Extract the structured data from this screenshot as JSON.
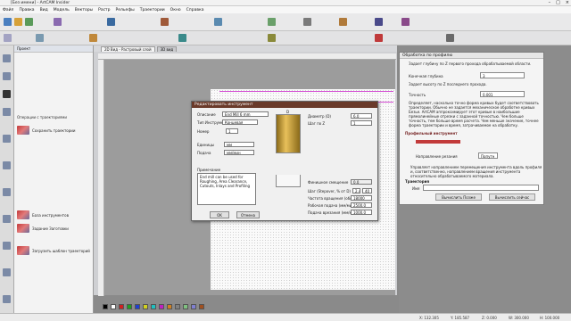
{
  "app": {
    "title": "[Без имени] - ArtCAM Insider",
    "menu": [
      "Файл",
      "Правка",
      "Вид",
      "Модель",
      "Векторы",
      "Растр",
      "Рельефы",
      "Траектории",
      "Окно",
      "Справка"
    ]
  },
  "tabs": [
    "2D Вид - Растровый слой",
    "3D вид"
  ],
  "left_panel": {
    "title": "Проект",
    "section": "Операции с траекториями",
    "items": [
      "Сохранить траектории",
      "База инструментов",
      "Задание Заготовки",
      "Загрузить шаблон траекторий"
    ]
  },
  "dialog": {
    "title": "Редактировать инструмент",
    "fields": {
      "description_label": "Описание",
      "description_value": "End Mill 6 mm",
      "tool_type_label": "Тип Инструмента",
      "tool_type_value": "Концевая",
      "number_label": "Номер",
      "number_value": "1",
      "units_label": "Единицы",
      "units_value": "мм",
      "feed_label": "Подача",
      "feed_value": "мм/мин",
      "diameter_label": "Диаметр (D)",
      "diameter_value": "6.0",
      "stepdown_label": "Шаг по Z",
      "stepdown_value": "1",
      "notes_label": "Примечание",
      "notes_value": "End mill can be used for Roughing, Area Clearance, Cutouts, Inlays and Profiling",
      "finish_offset_label": "Финишное смещение",
      "finish_offset_value": "0.0",
      "stepover_label": "Шаг (Stepover, % от D)",
      "stepover_percent": "2.4",
      "stepover_value": "40",
      "spindle_label": "Частота вращения (об/мин)",
      "spindle_value": "18000",
      "feed_rate_label": "Рабочая подача (мм/мин)",
      "feed_rate_value": "2500.0",
      "plunge_label": "Подача врезания (мм/мин)",
      "plunge_value": "1000.0",
      "tool_marker": "D"
    },
    "ok_label": "OK",
    "cancel_label": "Отмена"
  },
  "right_panel": {
    "title": "Обработка по профилю",
    "desc1": "Задает глубину по Z первого прохода обрабатываемой области.",
    "end_depth_label": "Конечная глубина",
    "end_depth_value": "3",
    "desc2": "Задает высоту по Z последнего прохода.",
    "tolerance_label": "Точность",
    "tolerance_value": "0.001",
    "desc3": "Определяет, насколько точно форма кривых будет соответствовать траектории. Обычно не задается механическое обработке кривых Безье. ArtCAM аппроксимирует этот кривые в наибольшие прямолинейные отрезки с заданной точностью. Чем больше точность, тем больше время расчета. Чем меньше значение, точнее форма траектории и время, затрачиваемое на обработку.",
    "tool_section": "Профильный инструмент",
    "direction_label": "Направление резания",
    "direction_value": "Попутн",
    "desc4": "Управляет направлением перемещения инструмента вдоль профиля и, соответственно, направлением вращения инструмента относительно обрабатываемого материала.",
    "traj_section": "Траектория",
    "name_label": "Имя",
    "calc_now": "Вычислить Позже",
    "calc_button": "Вычислить сейчас"
  },
  "status": {
    "x": "X: 132.305",
    "y": "Y: 185.587",
    "z": "Z: 0.000",
    "w": "W: 300.000",
    "h": "H: 100.000"
  },
  "colors": {
    "dialog_title": "#6a3a2a",
    "accent_red": "#c23a3a",
    "magenta_line": "#d24ad2"
  }
}
